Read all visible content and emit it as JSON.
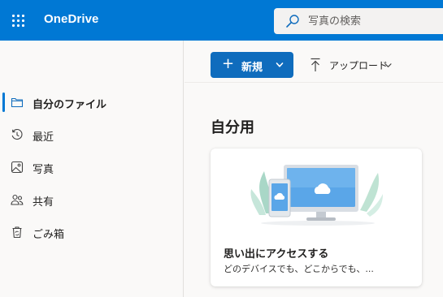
{
  "app": {
    "title": "OneDrive",
    "brand_color": "#0078d4"
  },
  "search": {
    "placeholder": "写真の検索",
    "value": ""
  },
  "sidebar": {
    "items": [
      {
        "label": "自分のファイル",
        "icon": "folder-icon",
        "selected": true
      },
      {
        "label": "最近",
        "icon": "history-icon",
        "selected": false
      },
      {
        "label": "写真",
        "icon": "photo-icon",
        "selected": false
      },
      {
        "label": "共有",
        "icon": "people-icon",
        "selected": false
      },
      {
        "label": "ごみ箱",
        "icon": "recycle-bin-icon",
        "selected": false
      }
    ]
  },
  "toolbar": {
    "new_label": "新規",
    "upload_label": "アップロード"
  },
  "main": {
    "section_title": "自分用",
    "card": {
      "title": "思い出にアクセスする",
      "subtitle": "どのデバイスでも、どこからでも、..."
    }
  }
}
